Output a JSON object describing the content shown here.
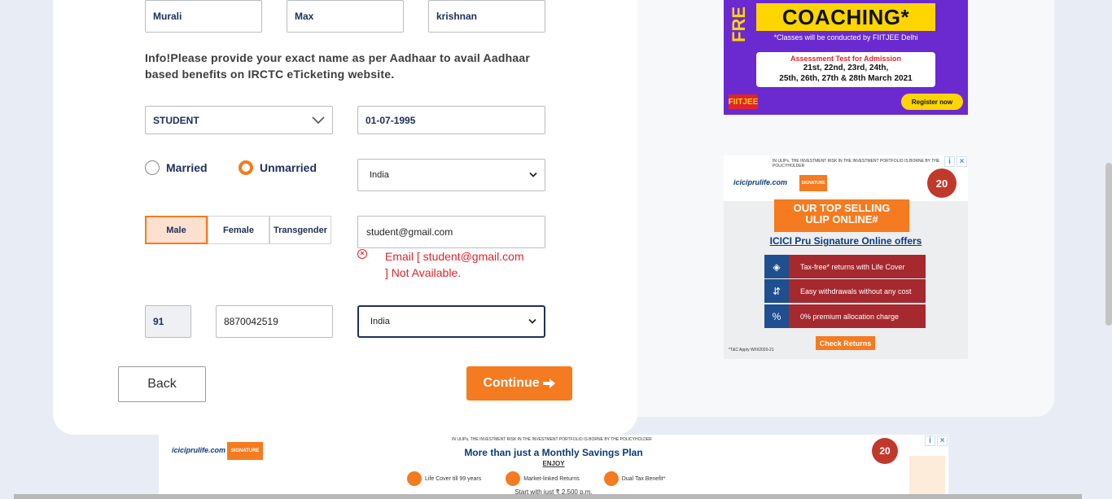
{
  "name_fields": {
    "first": "Murali",
    "middle": "Max",
    "last": "krishnan"
  },
  "info_text": "Info!Please provide your exact name as per Aadhaar to avail Aadhaar based benefits on IRCTC eTicketing website.",
  "occupation": {
    "selected": "STUDENT"
  },
  "dob": "01-07-1995",
  "marital": {
    "married_label": "Married",
    "unmarried_label": "Unmarried",
    "selected": "Unmarried"
  },
  "country_top": {
    "selected": "India"
  },
  "gender": {
    "male": "Male",
    "female": "Female",
    "transgender": "Transgender",
    "selected": "Male"
  },
  "email": {
    "value": "student@gmail.com",
    "error_line1": "Email [ student@gmail.com",
    "error_line2": "] Not Available."
  },
  "phone": {
    "isd": "91",
    "number": "8870042519"
  },
  "country_bottom": {
    "selected": "India"
  },
  "buttons": {
    "back": "Back",
    "continue": "Continue"
  },
  "ad_fiitjee": {
    "fr": "FRE",
    "headline": "COACHING*",
    "sub": "*Classes will be conducted by FIITJEE Delhi",
    "test_title": "Assessment Test for Admission",
    "dates_line1": "21st, 22nd, 23rd, 24th,",
    "dates_line2": "25th, 26th, 27th & 28th March 2021",
    "logo": "FIITJEE",
    "register": "Register now"
  },
  "ad_icici_side": {
    "fine_print": "IN ULIPs, THE INVESTMENT RISK IN THE INVESTMENT PORTFOLIO IS BORNE BY THE POLICYHOLDER",
    "brand": "iciciprulife.com",
    "signature": "SIGNATURE",
    "years": "20",
    "banner_line1": "OUR TOP SELLING",
    "banner_line2": "ULIP ONLINE#",
    "offers": "ICICI Pru Signature Online offers",
    "features": [
      "Tax-free* returns with Life Cover",
      "Easy withdrawals without any cost",
      "0% premium allocation charge"
    ],
    "cta": "Check Returns",
    "tc": "*T&C Apply W/II/2020-21"
  },
  "ad_icici_bottom": {
    "fine_print": "IN ULIPs, THE INVESTMENT RISK IN THE INVESTMENT PORTFOLIO IS BORNE BY THE POLICYHOLDER",
    "brand": "iciciprulife.com",
    "signature": "SIGNATURE",
    "headline": "More than just a Monthly Savings Plan",
    "enjoy": "ENJOY",
    "features": [
      "Life Cover till 99 years",
      "Market-linked Returns",
      "Dual Tax Benefit*"
    ],
    "start": "Start with just ₹ 2,500 p.m.",
    "years": "20"
  },
  "colors": {
    "accent": "#f47b20",
    "error": "#e0232d",
    "navy": "#20305c"
  }
}
